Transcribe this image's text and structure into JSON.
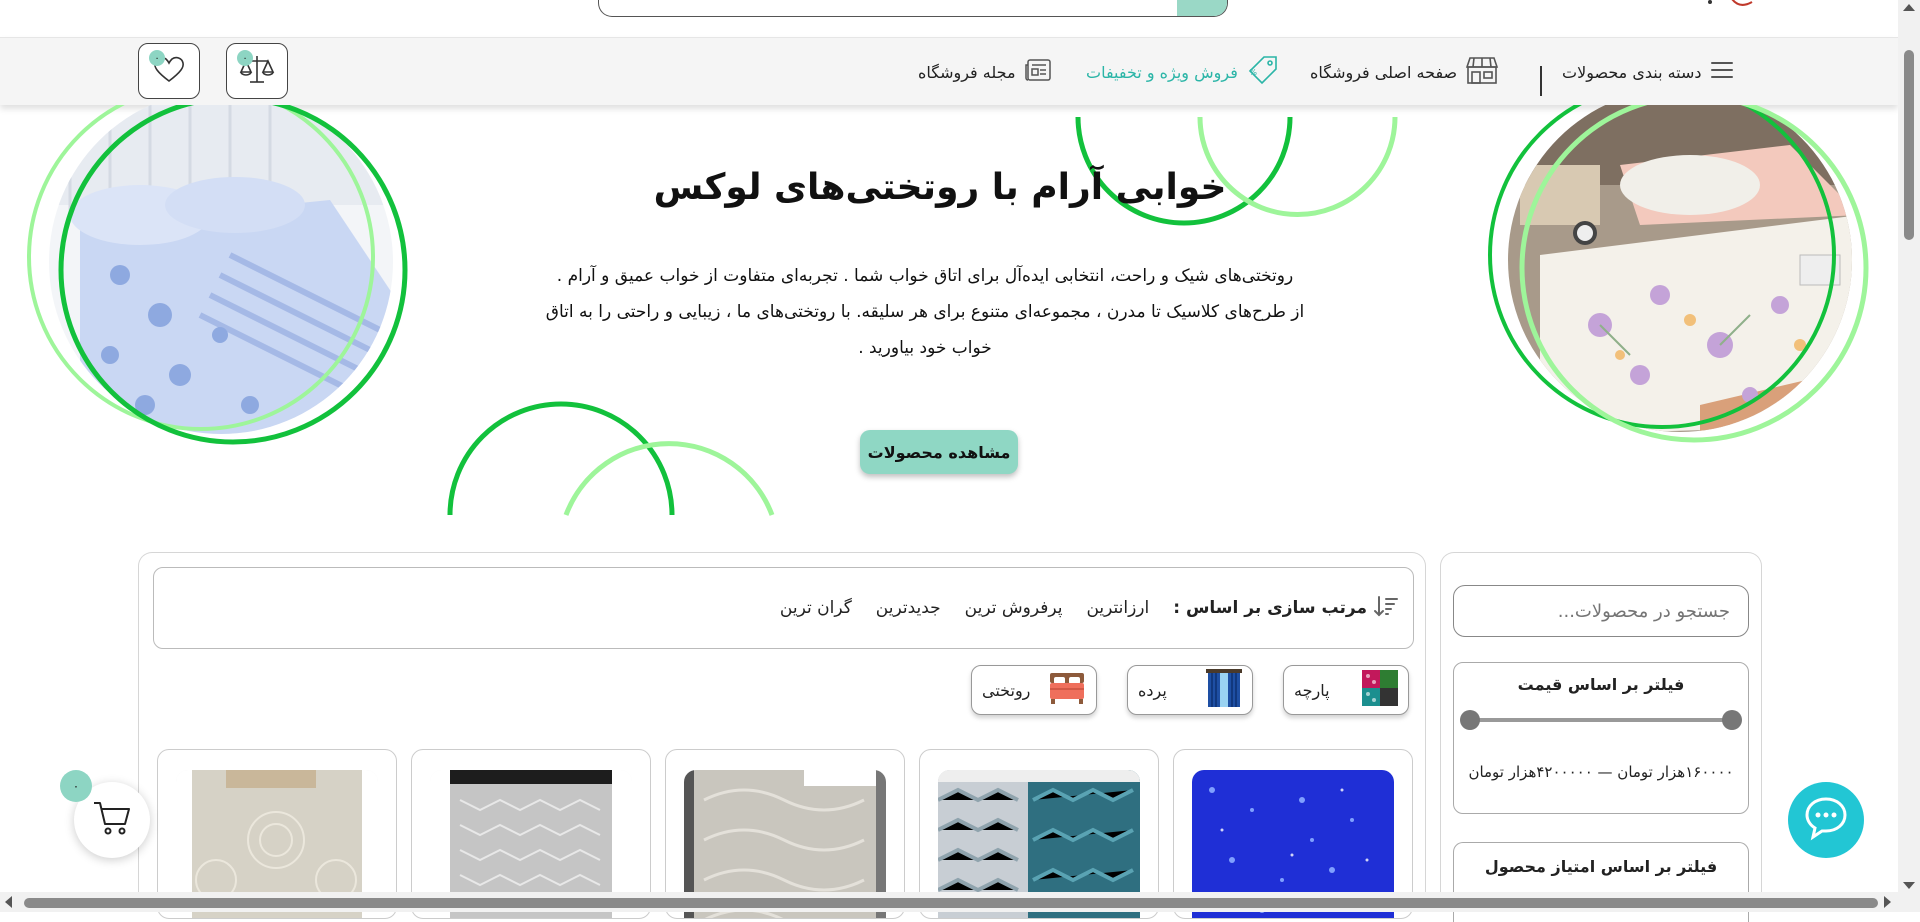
{
  "nav": {
    "categories": "دسته بندی محصولات",
    "home": "صفحه اصلی فروشگاه",
    "sale": "فروش ویژه و تخفیفات",
    "blog": "مجله فروشگاه",
    "compare_count": "۰",
    "wishlist_count": "۰"
  },
  "hero": {
    "title": "خوابی آرام با روتختی‌های لوکس",
    "line1": "روتختی‌های شیک و راحت، انتخابی ایده‌آل برای اتاق خواب شما . تجربه‌ای متفاوت از خواب عمیق و آرام .",
    "line2": "از طرح‌های کلاسیک تا مدرن ، مجموعه‌ای متنوع برای هر سلیقه. با روتختی‌های ما ، زیبایی و راحتی را به اتاق",
    "line3": "خواب خود بیاورید .",
    "button": "مشاهده محصولات"
  },
  "sidebar": {
    "search_placeholder": "جستجو در محصولات...",
    "price_title": "فیلتر بر اساس قیمت",
    "price_range": "۱۶۰۰۰۰هزار تومان — ۴۲۰۰۰۰۰هزار تومان",
    "rating_title": "فیلتر بر اساس امتیاز محصول"
  },
  "sort": {
    "title": "مرتب سازی بر اساس :",
    "options": [
      "ارزانترین",
      "پرفروش ترین",
      "جدیدترین",
      "گران ترین"
    ]
  },
  "categories": [
    "پارچه",
    "پرده",
    "روتختی"
  ],
  "cart": {
    "count": "۰"
  },
  "colors": {
    "accent": "#8dd5c3",
    "sale": "#2bb5a7",
    "chat": "#22c6d4",
    "ring_dark": "#12c13c",
    "ring_light": "#9ef59a"
  },
  "icons": [
    "menu-icon",
    "shop-icon",
    "tag-icon",
    "newspaper-icon",
    "scale-icon",
    "heart-icon",
    "sort-icon",
    "cart-icon",
    "chat-icon"
  ]
}
